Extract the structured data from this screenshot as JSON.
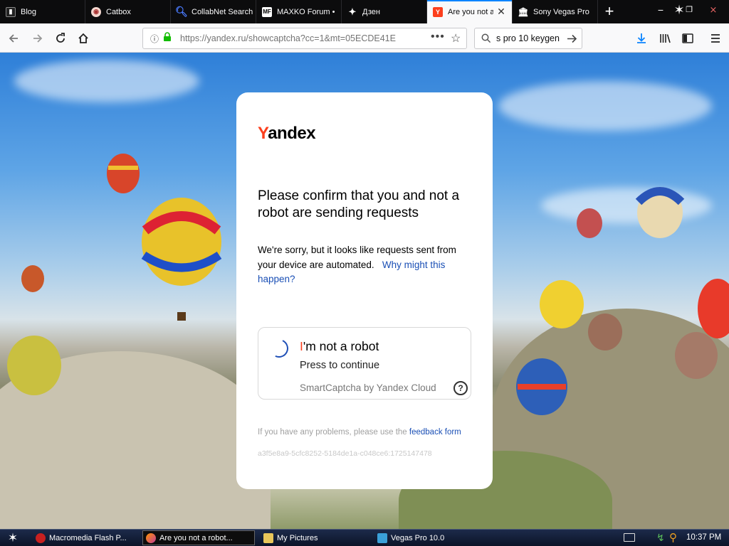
{
  "browser": {
    "tabs": [
      {
        "title": "Blog",
        "icon": "blog-favicon",
        "active": false
      },
      {
        "title": "Catbox",
        "icon": "catbox-favicon",
        "active": false
      },
      {
        "title": "CollabNet Search",
        "icon": "search-favicon",
        "active": false
      },
      {
        "title": "MAXKO Forum •",
        "icon": "mf-favicon",
        "active": false
      },
      {
        "title": "Дзен",
        "icon": "dzen-favicon",
        "active": false
      },
      {
        "title": "Are you not a robot?",
        "icon": "yandex-favicon",
        "active": true
      },
      {
        "title": "Sony Vegas Pro",
        "icon": "museum-favicon",
        "active": false
      }
    ],
    "url": "https://yandex.ru/showcaptcha?cc=1&mt=05ECDE41E",
    "search_value": "s pro 10 keygen",
    "colors": {
      "tabstrip": "#0c0c0d",
      "accent": "#0a84ff"
    }
  },
  "captcha": {
    "logo_initial": "Y",
    "logo_rest": "andex",
    "heading": "Please confirm that you and not a robot are sending requests",
    "message": "We're sorry, but it looks like requests sent from your device are automated.",
    "why_link": "Why might this happen?",
    "checkbox_initial": "I",
    "checkbox_rest": "'m not a robot",
    "press_to_continue": "Press to continue",
    "provider": "SmartCaptcha by Yandex Cloud",
    "help_glyph": "?",
    "problems_text": "If you have any problems, please use the",
    "feedback_link": "feedback form",
    "hash": "a3f5e8a9-5cfc8252-5184de1a-c048ce6:1725147478",
    "colors": {
      "brand_red": "#fc3f1d",
      "link": "#1a4fb5"
    }
  },
  "taskbar": {
    "items": [
      {
        "label": "Macromedia Flash P...",
        "icon": "flash-icon",
        "active": false
      },
      {
        "label": "Are you not a robot...",
        "icon": "firefox-icon",
        "active": true
      },
      {
        "label": "My Pictures",
        "icon": "folder-icon",
        "active": false
      },
      {
        "label": "Vegas Pro 10.0",
        "icon": "vegas-icon",
        "active": false
      }
    ],
    "clock": "10:37 PM"
  }
}
